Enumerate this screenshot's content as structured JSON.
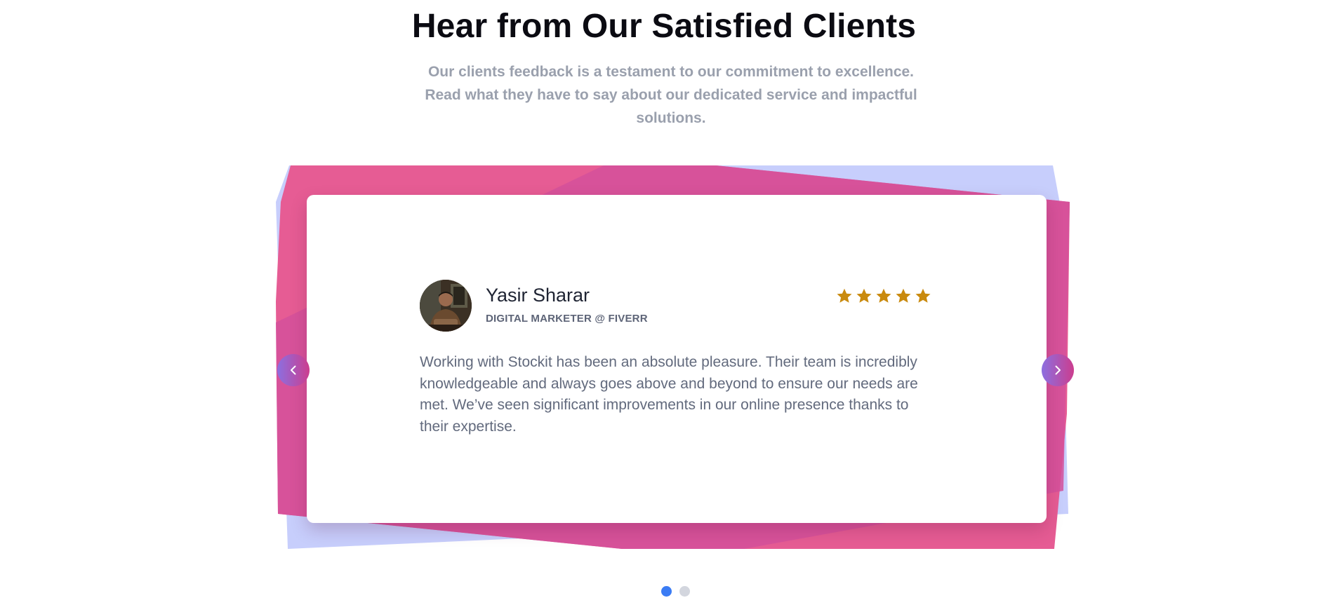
{
  "section": {
    "title": "Hear from Our Satisfied Clients",
    "subtitle": "Our clients feedback is a testament to our commitment to excellence. Read what they have to say about our dedicated service and impactful solutions."
  },
  "testimonial": {
    "name": "Yasir Sharar",
    "role": "DIGITAL MARKETER @ FIVERR",
    "rating": 5,
    "rating_max": 5,
    "quote": "Working with Stockit has been an absolute pleasure. Their team is incredibly knowledgeable and always goes above and beyond to ensure our needs are met. We’ve seen significant improvements in our online presence thanks to their expertise."
  },
  "carousel": {
    "prev_icon": "chevron-left-icon",
    "next_icon": "chevron-right-icon",
    "slide_count": 2,
    "active_slide": 1
  },
  "colors": {
    "heading": "#0b0b12",
    "subtitle": "#9aa0ad",
    "pink": "#e0458a",
    "magenta": "#cf4a96",
    "lavender": "#c7cefc",
    "star": "#c98a0e",
    "dot_active": "#3b7cf4",
    "dot_inactive": "#d3d6de"
  }
}
